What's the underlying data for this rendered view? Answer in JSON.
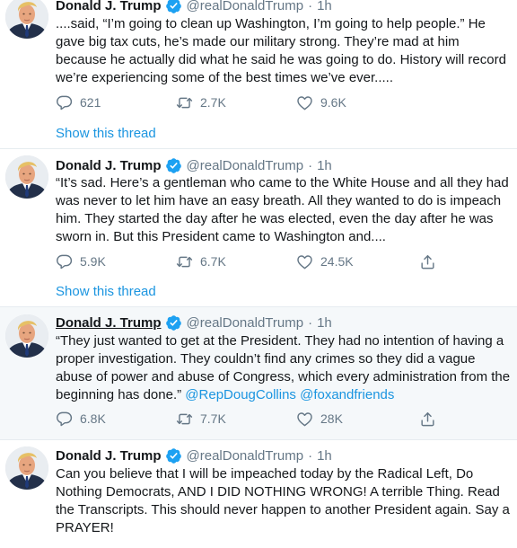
{
  "author": {
    "name": "Donald J. Trump",
    "handle": "@realDonaldTrump",
    "verified_icon": "verified-badge-icon",
    "avatar_icon": "profile-avatar"
  },
  "colors": {
    "link": "#1b95e0",
    "muted": "#657786",
    "border": "#e6ecf0",
    "hover_bg": "#f5f8fa",
    "verified": "#1da1f2"
  },
  "dot": "·",
  "tweets": [
    {
      "time": "1h",
      "text": "....said, “I’m going to clean up Washington, I’m going to help people.” He gave big tax cuts, he’s made our military strong. They’re mad at him because he actually did what he said he was going to do. History will record we’re experiencing some of the best times we’ve ever.....",
      "replies": "621",
      "retweets": "2.7K",
      "likes": "9.6K",
      "show_thread": "Show this thread"
    },
    {
      "time": "1h",
      "text": "“It’s sad. Here’s a gentleman who came to the White House and all they had was never to let him have an easy breath. All they wanted to do is impeach him. They started the day after he was elected, even the day after he was sworn in.  But this President came to Washington and....",
      "replies": "5.9K",
      "retweets": "6.7K",
      "likes": "24.5K",
      "show_thread": "Show this thread"
    },
    {
      "time": "1h",
      "text": "“They just wanted to get at the President. They had no intention of having a proper investigation. They couldn’t find any crimes so they did a vague abuse of power and abuse of Congress, which every administration from the beginning has done.”",
      "mention1": "@RepDougCollins",
      "mention2": "@foxandfriends",
      "replies": "6.8K",
      "retweets": "7.7K",
      "likes": "28K"
    },
    {
      "time": "1h",
      "text": "Can you believe that I will be impeached today by the Radical Left, Do Nothing Democrats, AND I DID NOTHING WRONG! A terrible Thing. Read the Transcripts. This should never happen to another President again. Say a PRAYER!"
    }
  ]
}
